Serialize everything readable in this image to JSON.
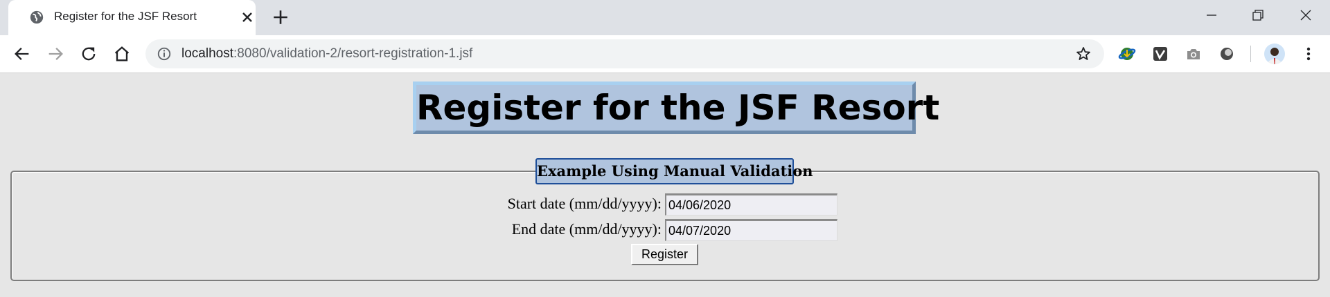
{
  "browser": {
    "tab": {
      "title": "Register for the JSF Resort",
      "icon": "globe-icon"
    },
    "address_bar": {
      "host": "localhost",
      "path": ":8080/validation-2/resort-registration-1.jsf"
    },
    "extensions": [
      "download-manager-icon",
      "vimeo-icon",
      "camera-icon",
      "circle-extension-icon"
    ]
  },
  "page": {
    "title": "Register for the JSF Resort",
    "form": {
      "legend": "Example Using Manual Validation",
      "start_label": "Start date (mm/dd/yyyy):",
      "start_value": "04/06/2020",
      "end_label": "End date (mm/dd/yyyy):",
      "end_value": "04/07/2020",
      "submit_label": "Register"
    }
  },
  "colors": {
    "title_background": "#b0c4de",
    "legend_border": "#1f4f99",
    "page_background": "#e6e6e6"
  }
}
